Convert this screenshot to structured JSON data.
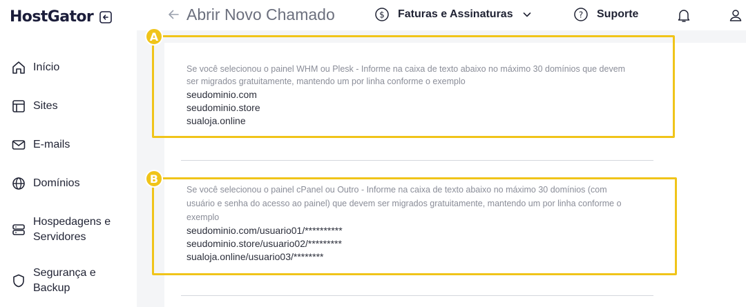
{
  "brand": {
    "name": "HostGator"
  },
  "sidebar": {
    "items": [
      {
        "label": "Início",
        "icon": "home-icon"
      },
      {
        "label": "Sites",
        "icon": "layout-icon"
      },
      {
        "label": "E-mails",
        "icon": "mail-icon"
      },
      {
        "label": "Domínios",
        "icon": "globe-icon"
      },
      {
        "label": "Hospedagens e",
        "label2": "Servidores",
        "icon": "server-icon"
      },
      {
        "label": "Segurança e",
        "label2": "Backup",
        "icon": "shield-icon"
      }
    ]
  },
  "header": {
    "title": "Abrir Novo Chamado",
    "billing_label": "Faturas e Assinaturas",
    "support_label": "Suporte"
  },
  "form": {
    "block_a": {
      "badge": "A",
      "hint_line1": "Se você selecionou o painel WHM ou Plesk - Informe na caixa de texto abaixo no máximo 30 domínios que devem",
      "hint_line2": "ser migrados gratuitamente, mantendo um por linha conforme o exemplo",
      "examples": [
        "seudominio.com",
        "seudominio.store",
        "sualoja.online"
      ]
    },
    "block_b": {
      "badge": "B",
      "hint_line1": "Se você selecionou o painel cPanel ou Outro - Informe na caixa de texto abaixo no máximo 30 domínios (com",
      "hint_line2": "usuário e senha do acesso ao painel) que devem ser migrados gratuitamente, mantendo um por linha conforme o",
      "hint_line3": "exemplo",
      "examples": [
        "seudominio.com/usuario01/**********",
        "seudominio.store/usuario02/*********",
        "sualoja.online/usuario03/********"
      ]
    }
  },
  "colors": {
    "highlight": "#f0c419",
    "brand_dark": "#1b1d3a",
    "hint_text": "#8a8d98"
  }
}
